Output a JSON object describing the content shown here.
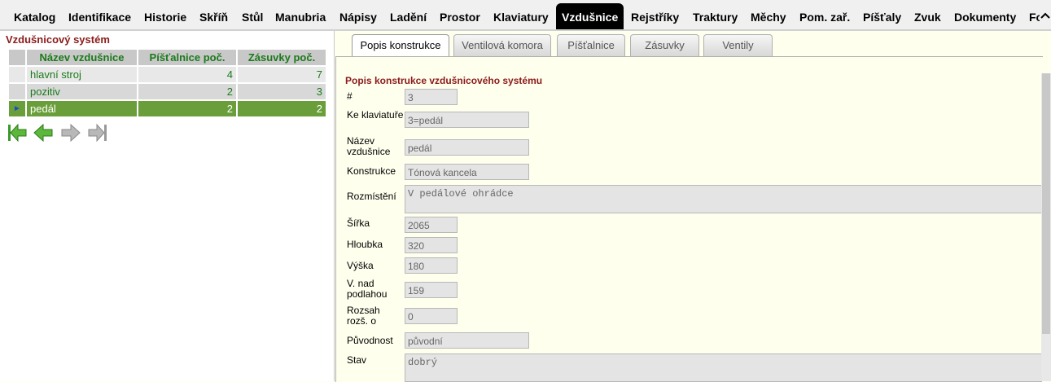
{
  "nav": {
    "tabs": [
      {
        "label": "Katalog"
      },
      {
        "label": "Identifikace"
      },
      {
        "label": "Historie"
      },
      {
        "label": "Skříň"
      },
      {
        "label": "Stůl"
      },
      {
        "label": "Manubria"
      },
      {
        "label": "Nápisy"
      },
      {
        "label": "Ladění"
      },
      {
        "label": "Prostor"
      },
      {
        "label": "Klaviatury"
      },
      {
        "label": "Vzdušnice"
      },
      {
        "label": "Rejstříky"
      },
      {
        "label": "Traktury"
      },
      {
        "label": "Měchy"
      },
      {
        "label": "Pom. zař."
      },
      {
        "label": "Píšťaly"
      },
      {
        "label": "Zvuk"
      },
      {
        "label": "Dokumenty"
      },
      {
        "label": "Fo"
      }
    ],
    "active": "Vzdušnice"
  },
  "left": {
    "title": "Vzdušnicový systém",
    "columns": [
      "Název vzdušnice",
      "Píšťalnice poč.",
      "Zásuvky poč."
    ],
    "rows": [
      {
        "name": "hlavní stroj",
        "pistalnice": "4",
        "zasuvky": "7",
        "selected": false
      },
      {
        "name": "pozitiv",
        "pistalnice": "2",
        "zasuvky": "3",
        "selected": false
      },
      {
        "name": "pedál",
        "pistalnice": "2",
        "zasuvky": "2",
        "selected": true
      }
    ],
    "row_indicator": "►",
    "nav_buttons": [
      "first-icon",
      "prev-icon",
      "next-icon",
      "last-icon"
    ]
  },
  "form": {
    "tabs": [
      "Popis konstrukce",
      "Ventilová komora",
      "Píšťalnice",
      "Zásuvky",
      "Ventily"
    ],
    "active_tab": "Popis konstrukce",
    "title": "Popis konstrukce vzdušnicového systému",
    "fields": {
      "cislo": {
        "label": "#",
        "value": "3"
      },
      "klaviatura": {
        "label": "Ke klaviatuře",
        "value": "3=pedál"
      },
      "nazev": {
        "label": "Název vzdušnice",
        "value": "pedál"
      },
      "konstrukce": {
        "label": "Konstrukce",
        "value": "Tónová kancela"
      },
      "rozmisteni": {
        "label": "Rozmístění",
        "value": "V pedálové ohrádce"
      },
      "sirka": {
        "label": "Šířka",
        "value": "2065"
      },
      "hloubka": {
        "label": "Hloubka",
        "value": "320"
      },
      "vyska": {
        "label": "Výška",
        "value": "180"
      },
      "nadpodlahou": {
        "label": "V. nad podlahou",
        "value": "159"
      },
      "rozsah": {
        "label": "Rozsah rozš. o",
        "value": "0"
      },
      "puvodnost": {
        "label": "Původnost",
        "value": "původní"
      },
      "stav": {
        "label": "Stav",
        "value": "dobrý"
      }
    }
  },
  "colors": {
    "accent": "#8b1a1a",
    "green": "#1a7a1a",
    "selected": "#6a9e3a",
    "background": "#ffffee"
  }
}
